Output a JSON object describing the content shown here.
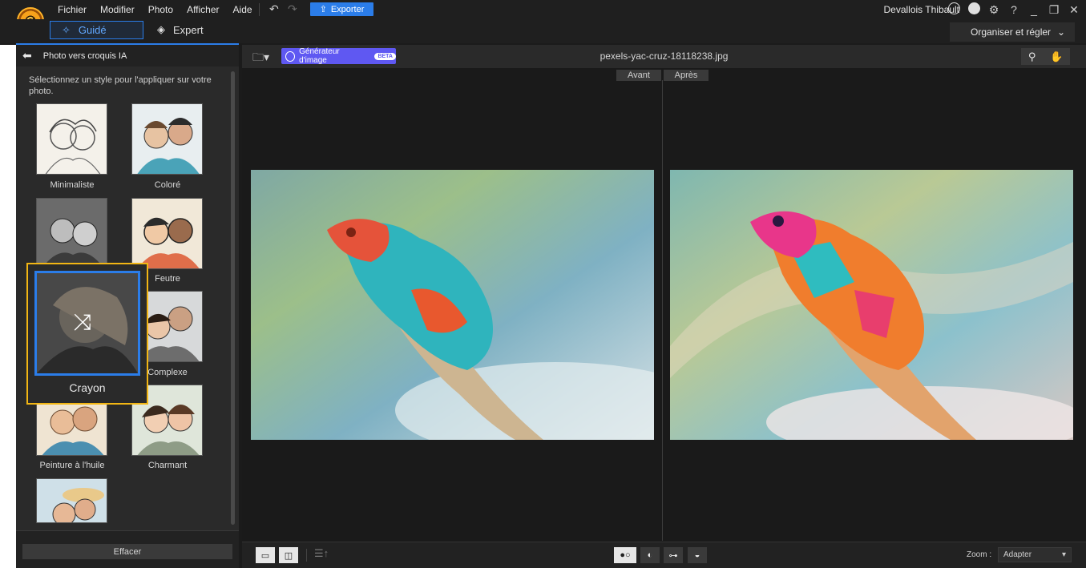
{
  "menu": [
    "Fichier",
    "Modifier",
    "Photo",
    "Afficher",
    "Aide"
  ],
  "toolbar": {
    "export_label": "Exporter",
    "undo_icon": "undo-icon",
    "redo_icon": "redo-icon"
  },
  "user": {
    "name": "Devallois Thibault"
  },
  "modes": {
    "guide": "Guidé",
    "expert": "Expert"
  },
  "workspace": {
    "label": "Organiser et régler"
  },
  "panel": {
    "title": "Photo vers croquis IA",
    "hint": "Sélectionnez un style pour l'appliquer sur votre photo.",
    "styles": [
      "Minimaliste",
      "Coloré",
      "Feutre",
      "Complexe",
      "Peinture à l'huile",
      "Charmant"
    ],
    "hover_style": "Crayon",
    "clear_button": "Effacer"
  },
  "viewer": {
    "generator_label": "Générateur d'image",
    "beta_badge": "BETA",
    "filename": "pexels-yac-cruz-18118238.jpg",
    "before_label": "Avant",
    "after_label": "Après",
    "zoom_label": "Zoom :",
    "zoom_value": "Adapter"
  }
}
